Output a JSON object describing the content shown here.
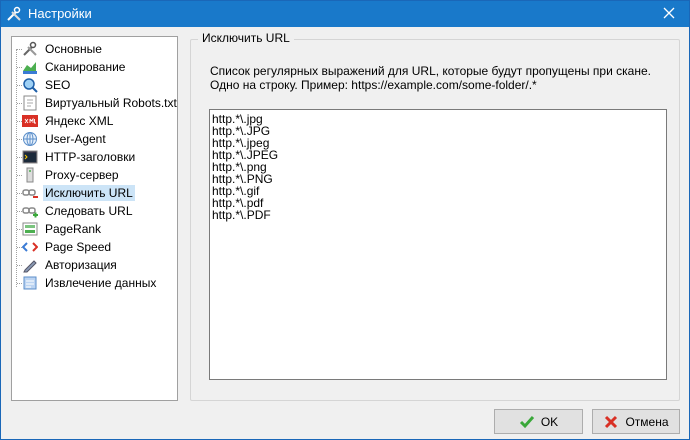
{
  "window": {
    "title": "Настройки"
  },
  "sidebar": {
    "items": [
      {
        "label": "Основные",
        "icon": "tools-icon"
      },
      {
        "label": "Сканирование",
        "icon": "chart-icon"
      },
      {
        "label": "SEO",
        "icon": "magnifier-icon"
      },
      {
        "label": "Виртуальный Robots.txt",
        "icon": "robots-file-icon"
      },
      {
        "label": "Яндекс XML",
        "icon": "xml-icon"
      },
      {
        "label": "User-Agent",
        "icon": "globe-icon"
      },
      {
        "label": "HTTP-заголовки",
        "icon": "terminal-icon"
      },
      {
        "label": "Proxy-сервер",
        "icon": "server-icon"
      },
      {
        "label": "Исключить URL",
        "icon": "exclude-link-icon",
        "selected": true
      },
      {
        "label": "Следовать URL",
        "icon": "follow-link-icon"
      },
      {
        "label": "PageRank",
        "icon": "pagerank-icon"
      },
      {
        "label": "Page Speed",
        "icon": "code-icon"
      },
      {
        "label": "Авторизация",
        "icon": "pen-icon"
      },
      {
        "label": "Извлечение данных",
        "icon": "extract-icon"
      }
    ]
  },
  "main": {
    "group_title": "Исключить URL",
    "description_line1": "Список регулярных выражений для URL, которые будут пропущены при скане.",
    "description_line2": "Одно на строку. Пример: https://example.com/some-folder/.*",
    "patterns": [
      "http.*\\.jpg",
      "http.*\\.JPG",
      "http.*\\.jpeg",
      "http.*\\.JPEG",
      "http.*\\.png",
      "http.*\\.PNG",
      "http.*\\.gif",
      "http.*\\.pdf",
      "http.*\\.PDF"
    ]
  },
  "buttons": {
    "ok_label": "OK",
    "cancel_label": "Отмена"
  },
  "colors": {
    "titlebar": "#1979ca",
    "selection": "#cce4f7",
    "ok_check": "#3aa83a",
    "cancel_x": "#d93025"
  }
}
